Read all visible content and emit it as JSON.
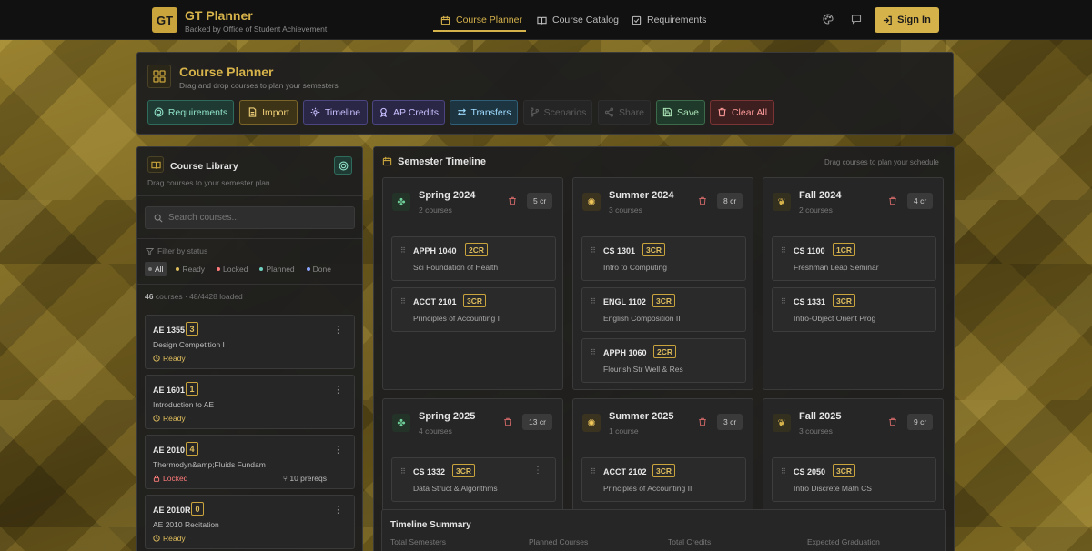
{
  "header": {
    "logo_text": "GT",
    "brand_title": "GT Planner",
    "brand_subtitle": "Backed by Office of Student Achievement",
    "nav": [
      {
        "label": "Course Planner",
        "icon": "calendar-icon",
        "active": true
      },
      {
        "label": "Course Catalog",
        "icon": "book-icon",
        "active": false
      },
      {
        "label": "Requirements",
        "icon": "checklist-icon",
        "active": false
      }
    ],
    "sign_in_label": "Sign In"
  },
  "planner": {
    "title": "Course Planner",
    "subtitle": "Drag and drop courses to plan your semesters",
    "toolbar": {
      "requirements": "Requirements",
      "import": "Import",
      "timeline": "Timeline",
      "ap_credits": "AP Credits",
      "transfers": "Transfers",
      "scenarios": "Scenarios",
      "share": "Share",
      "save": "Save",
      "clear_all": "Clear All"
    }
  },
  "library": {
    "title": "Course Library",
    "subtitle": "Drag courses to your semester plan",
    "search_placeholder": "Search courses...",
    "filter_label": "Filter by status",
    "filters": [
      {
        "label": "All",
        "color": "#888888"
      },
      {
        "label": "Ready",
        "color": "#e0be5c"
      },
      {
        "label": "Locked",
        "color": "#ff7b7b"
      },
      {
        "label": "Planned",
        "color": "#6fd1c0"
      },
      {
        "label": "Done",
        "color": "#8aa4ff"
      }
    ],
    "count_number": "46",
    "count_text": "courses · 48/4428 loaded",
    "courses": [
      {
        "code": "AE 1355",
        "credits": "3",
        "name": "Design Competition I",
        "status": "Ready"
      },
      {
        "code": "AE 1601",
        "credits": "1",
        "name": "Introduction to AE",
        "status": "Ready"
      },
      {
        "code": "AE 2010",
        "credits": "4",
        "name": "Thermodyn&amp;Fluids Fundam",
        "status": "Locked",
        "prereqs": "10 prereqs"
      },
      {
        "code": "AE 2010R",
        "credits": "0",
        "name": "AE 2010 Recitation",
        "status": "Ready"
      }
    ]
  },
  "timeline": {
    "title": "Semester Timeline",
    "hint": "Drag courses to plan your schedule",
    "semesters": [
      {
        "name": "Spring 2024",
        "count": "2 courses",
        "credits": "5 cr",
        "icon": "flower-icon",
        "courses": [
          {
            "code": "APPH 1040",
            "cr": "2CR",
            "name": "Sci Foundation of Health"
          },
          {
            "code": "ACCT 2101",
            "cr": "3CR",
            "name": "Principles of Accounting I"
          }
        ]
      },
      {
        "name": "Summer 2024",
        "count": "3 courses",
        "credits": "8 cr",
        "icon": "sun-icon",
        "courses": [
          {
            "code": "CS 1301",
            "cr": "3CR",
            "name": "Intro to Computing"
          },
          {
            "code": "ENGL 1102",
            "cr": "3CR",
            "name": "English Composition II"
          },
          {
            "code": "APPH 1060",
            "cr": "2CR",
            "name": "Flourish Str Well & Res"
          }
        ]
      },
      {
        "name": "Fall 2024",
        "count": "2 courses",
        "credits": "4 cr",
        "icon": "leaf-icon",
        "courses": [
          {
            "code": "CS 1100",
            "cr": "1CR",
            "name": "Freshman Leap Seminar"
          },
          {
            "code": "CS 1331",
            "cr": "3CR",
            "name": "Intro-Object Orient Prog"
          }
        ]
      },
      {
        "name": "Spring 2025",
        "count": "4 courses",
        "credits": "13 cr",
        "icon": "flower-icon",
        "courses": [
          {
            "code": "CS 1332",
            "cr": "3CR",
            "name": "Data Struct & Algorithms"
          }
        ]
      },
      {
        "name": "Summer 2025",
        "count": "1 course",
        "credits": "3 cr",
        "icon": "sun-icon",
        "courses": [
          {
            "code": "ACCT 2102",
            "cr": "3CR",
            "name": "Principles of Accounting II"
          }
        ]
      },
      {
        "name": "Fall 2025",
        "count": "3 courses",
        "credits": "9 cr",
        "icon": "leaf-icon",
        "courses": [
          {
            "code": "CS 2050",
            "cr": "3CR",
            "name": "Intro Discrete Math CS"
          }
        ]
      }
    ],
    "summary": {
      "title": "Timeline Summary",
      "labels": [
        "Total Semesters",
        "Planned Courses",
        "Total Credits",
        "Expected Graduation"
      ]
    }
  }
}
